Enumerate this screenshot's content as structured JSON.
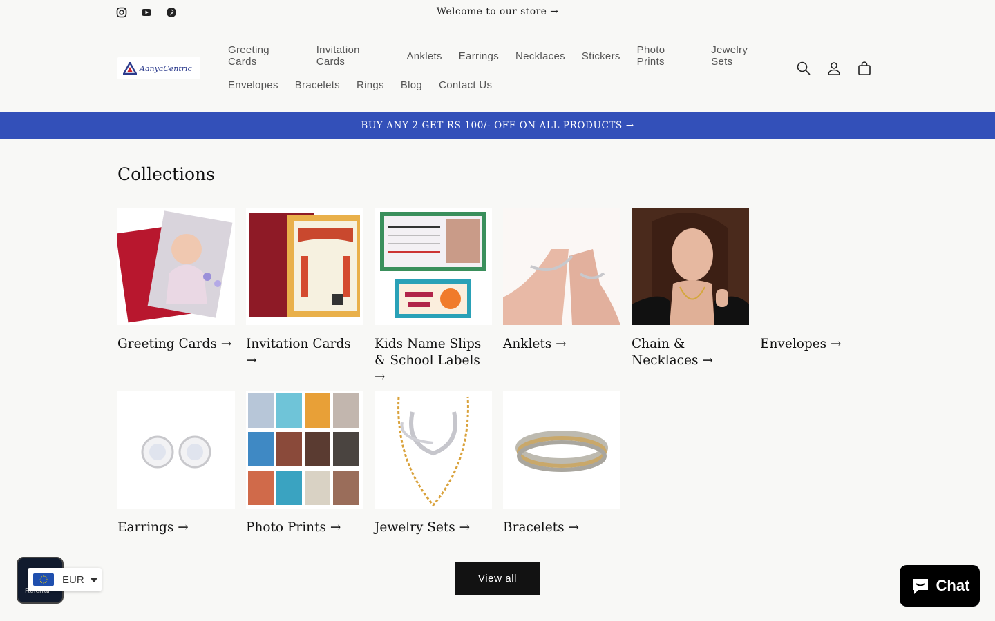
{
  "announcement": {
    "text": "Welcome to our store →",
    "social": [
      "instagram-icon",
      "youtube-icon",
      "pinterest-icon"
    ]
  },
  "header": {
    "logo_text": "AanyaCentric",
    "nav_row1": [
      "Greeting Cards",
      "Invitation Cards",
      "Anklets",
      "Earrings",
      "Necklaces",
      "Stickers",
      "Photo Prints",
      "Jewelry Sets"
    ],
    "nav_row2": [
      "Envelopes",
      "Bracelets",
      "Rings",
      "Blog",
      "Contact Us"
    ],
    "icons": [
      "search-icon",
      "account-icon",
      "cart-icon"
    ]
  },
  "promo": {
    "text": "BUY ANY 2 GET RS 100/- OFF ON ALL PRODUCTS →"
  },
  "collections": {
    "title": "Collections",
    "items": [
      {
        "label": "Greeting Cards →"
      },
      {
        "label": "Invitation Cards →"
      },
      {
        "label": "Kids Name Slips & School Labels →"
      },
      {
        "label": "Anklets →"
      },
      {
        "label": "Chain & Necklaces →"
      },
      {
        "label": "Envelopes →"
      },
      {
        "label": "Earrings →"
      },
      {
        "label": "Photo Prints →"
      },
      {
        "label": "Jewelry Sets →"
      },
      {
        "label": "Bracelets →"
      }
    ],
    "view_all": "View all"
  },
  "currency": {
    "code": "EUR",
    "badge": "Referral"
  },
  "chat": {
    "label": "Chat"
  },
  "colors": {
    "promo_bg": "#3350b9",
    "button_bg": "#121212"
  }
}
